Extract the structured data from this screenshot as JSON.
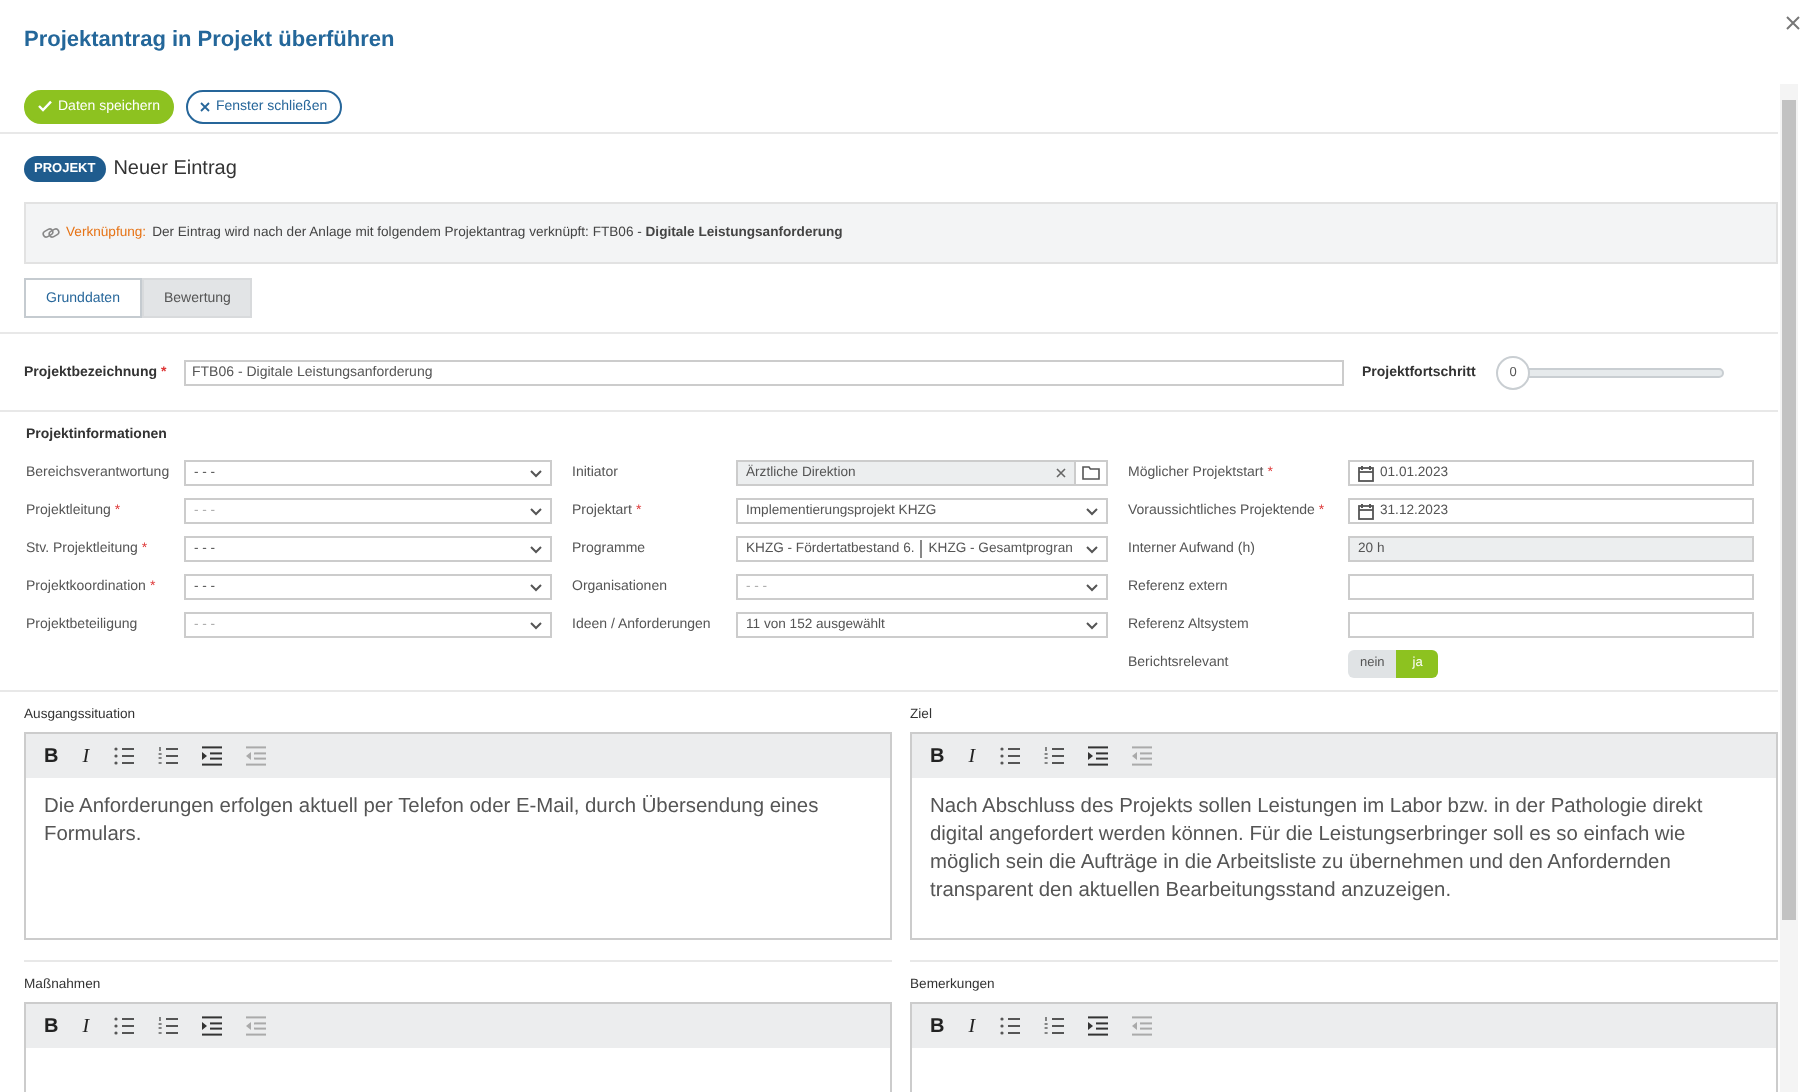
{
  "window": {
    "title": "Projektantrag in Projekt überführen"
  },
  "actions": [
    {
      "kind": "primary",
      "label": "Daten speichern"
    },
    {
      "kind": "secondary",
      "label": "Fenster schließen"
    }
  ],
  "record": {
    "badge": "PROJEKT",
    "title": "Neuer Eintrag"
  },
  "notice": {
    "label": "Verknüpfung:",
    "text": "Der Eintrag wird nach der Anlage mit folgendem Projektantrag verknüpft: FTB06 - **Digitale Leistungsanforderung**"
  },
  "tabs": [
    {
      "label": "Grunddaten",
      "selected": true
    },
    {
      "label": "Bewertung",
      "selected": false
    }
  ],
  "title_field": {
    "label": "Projektbezeichnung",
    "required_mark": "*",
    "value": "FTB06 - Digitale Leistungsanforderung"
  },
  "progress": {
    "label": "Projektfortschritt",
    "value": "0",
    "level": 0
  },
  "section_title": "Projektinformationen",
  "columns": [
    [
      {
        "kind": "select",
        "label": "Bereichsverantwortung",
        "value": "- - -",
        "readonly": false
      },
      {
        "kind": "select",
        "label": "Projektleitung",
        "required_mark": "*",
        "placeholder": "- - -",
        "readonly": false
      },
      {
        "kind": "select",
        "label": "Stv. Projektleitung",
        "required_mark": "*",
        "value": "- - -",
        "readonly": false
      },
      {
        "kind": "select",
        "label": "Projektkoordination",
        "required_mark": "*",
        "value": "- - -",
        "readonly": false
      },
      {
        "kind": "select",
        "label": "Projektbeteiligung",
        "placeholder": "- - -",
        "readonly": false
      }
    ],
    [
      {
        "kind": "picker",
        "label": "Initiator",
        "value": "Ärztliche Direktion",
        "readonly": true
      },
      {
        "kind": "select",
        "label": "Projektart",
        "required_mark": "*",
        "value": "Implementierungsprojekt KHZG",
        "readonly": false
      },
      {
        "kind": "multi",
        "label": "Programme",
        "values": [
          "KHZG - Fördertatbestand 6.",
          "KHZG - Gesamtprogran"
        ],
        "readonly": false
      },
      {
        "kind": "select",
        "label": "Organisationen",
        "placeholder": "- - -",
        "readonly": false
      },
      {
        "kind": "select",
        "label": "Ideen / Anforderungen",
        "value": "11 von 152 ausgewählt",
        "readonly": false
      }
    ],
    [
      {
        "kind": "date",
        "label": "Möglicher Projektstart",
        "required_mark": "*",
        "value": "01.01.2023",
        "readonly": false
      },
      {
        "kind": "date",
        "label": "Voraussichtliches Projektende",
        "required_mark": "*",
        "value": "31.12.2023",
        "readonly": false
      },
      {
        "kind": "text",
        "label": "Interner Aufwand (h)",
        "value": "20 h",
        "readonly": true
      },
      {
        "kind": "text",
        "label": "Referenz extern",
        "readonly": false
      },
      {
        "kind": "text",
        "label": "Referenz Altsystem",
        "readonly": false
      },
      {
        "kind": "toggle",
        "label": "Berichtsrelevant",
        "options": [
          {
            "label": "nein",
            "selected": false
          },
          {
            "label": "ja",
            "selected": true
          }
        ]
      }
    ]
  ],
  "editors": [
    {
      "label": "Ausgangssituation",
      "toolbar": [
        "B",
        "I"
      ],
      "text": "Die Anforderungen erfolgen aktuell per Telefon oder E-Mail, durch Übersendung eines Formulars."
    },
    {
      "label": "Ziel",
      "toolbar": [
        "B",
        "I"
      ],
      "text": "Nach Abschluss des Projekts sollen Leistungen im Labor bzw. in der Pathologie direkt digital angefordert werden können. Für die Leistungserbringer soll es so einfach wie möglich sein die Aufträge in die Arbeitsliste zu übernehmen und den Anfordernden transparent den aktuellen Bearbeitungsstand anzuzeigen."
    },
    {
      "label": "Maßnahmen",
      "toolbar": [
        "B",
        "I"
      ]
    },
    {
      "label": "Bemerkungen",
      "toolbar": [
        "B",
        "I"
      ]
    }
  ]
}
